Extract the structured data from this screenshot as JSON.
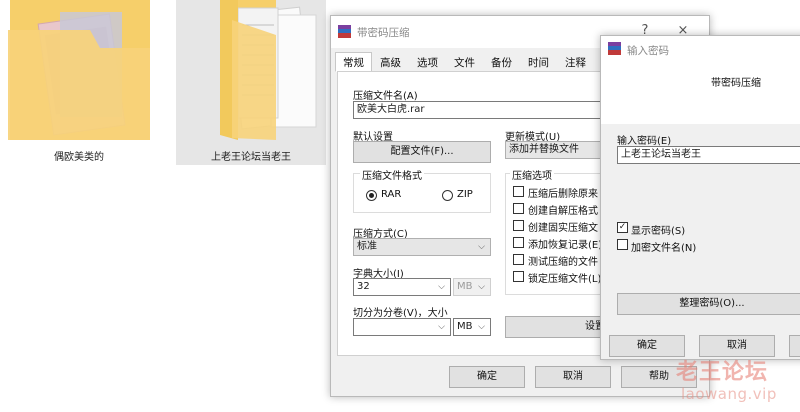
{
  "desktop": {
    "folders": [
      {
        "label": "偶欧美类的"
      },
      {
        "label": "上老王论坛当老王"
      }
    ]
  },
  "main_dialog": {
    "title": "带密码压缩",
    "help_btn": "?",
    "close_btn": "×",
    "tabs": [
      "常规",
      "高级",
      "选项",
      "文件",
      "备份",
      "时间",
      "注释"
    ],
    "archive_name_label": "压缩文件名(A)",
    "archive_name_value": "欧美大白虎.rar",
    "default_settings_label": "默认设置",
    "profiles_button": "配置文件(F)...",
    "update_mode_label": "更新模式(U)",
    "update_mode_value": "添加并替换文件",
    "format_group_label": "压缩文件格式",
    "format_rar": "RAR",
    "format_zip": "ZIP",
    "format_selected": "RAR",
    "method_label": "压缩方式(C)",
    "method_value": "标准",
    "dict_label": "字典大小(I)",
    "dict_value": "32",
    "dict_unit": "MB",
    "split_label": "切分为分卷(V)，大小",
    "split_value": "",
    "split_unit": "MB",
    "options_group_label": "压缩选项",
    "options": [
      {
        "label": "压缩后删除原来",
        "checked": false
      },
      {
        "label": "创建自解压格式",
        "checked": false
      },
      {
        "label": "创建固实压缩文",
        "checked": false
      },
      {
        "label": "添加恢复记录(E)",
        "checked": false
      },
      {
        "label": "测试压缩的文件",
        "checked": false
      },
      {
        "label": "锁定压缩文件(L)",
        "checked": false
      }
    ],
    "set_password_button": "设置密码",
    "ok_button": "确定",
    "cancel_button": "取消",
    "help_button": "帮助"
  },
  "password_dialog": {
    "title": "输入密码",
    "heading": "带密码压缩",
    "enter_password_label": "输入密码(E)",
    "password_value": "上老王论坛当老王",
    "show_password_label": "显示密码(S)",
    "show_password_checked": true,
    "encrypt_names_label": "加密文件名(N)",
    "encrypt_names_checked": false,
    "organize_button": "整理密码(O)...",
    "ok_button": "确定",
    "cancel_button": "取消"
  },
  "watermark": {
    "cn": "老王论坛",
    "en": "laowang.vip"
  }
}
